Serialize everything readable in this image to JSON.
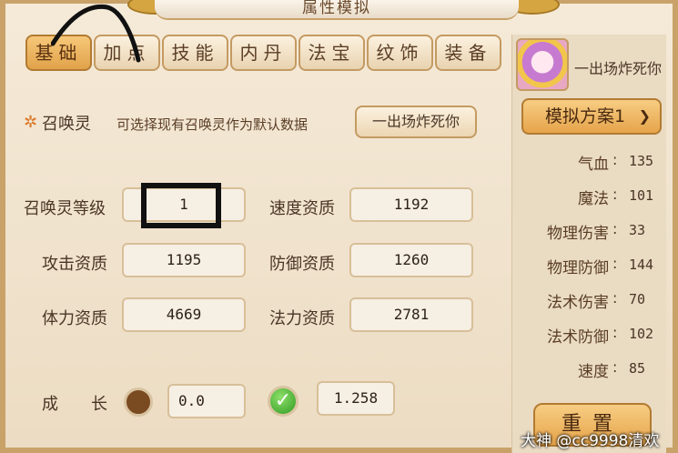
{
  "window": {
    "title": "属性模拟"
  },
  "tabs": [
    {
      "label": "基础",
      "active": true
    },
    {
      "label": "加点"
    },
    {
      "label": "技能"
    },
    {
      "label": "内丹"
    },
    {
      "label": "法宝"
    },
    {
      "label": "纹饰"
    },
    {
      "label": "装备"
    }
  ],
  "summon": {
    "title": "召唤灵",
    "hint": "可选择现有召唤灵作为默认数据",
    "selected": "一出场炸死你"
  },
  "fields": {
    "level": {
      "label": "召唤灵等级",
      "value": "1"
    },
    "speed": {
      "label": "速度资质",
      "value": "1192"
    },
    "attack": {
      "label": "攻击资质",
      "value": "1195"
    },
    "defense": {
      "label": "防御资质",
      "value": "1260"
    },
    "stamina": {
      "label": "体力资质",
      "value": "4669"
    },
    "magic": {
      "label": "法力资质",
      "value": "2781"
    },
    "growth": {
      "label": "成　　长",
      "base": "0.0",
      "current": "1.258"
    }
  },
  "sidebar": {
    "name": "一出场炸死你",
    "scheme": "模拟方案1",
    "stats": [
      {
        "label": "气血",
        "value": "135"
      },
      {
        "label": "魔法",
        "value": "101"
      },
      {
        "label": "物理伤害",
        "value": "33"
      },
      {
        "label": "物理防御",
        "value": "144"
      },
      {
        "label": "法术伤害",
        "value": "70"
      },
      {
        "label": "法术防御",
        "value": "102"
      },
      {
        "label": "速度",
        "value": "85"
      }
    ],
    "reset": "重置"
  },
  "watermark": "大神 @cc9998清欢",
  "colors": {
    "accent": "#e6a44b",
    "frame": "#c9a26a",
    "check": "#2f9a22"
  }
}
